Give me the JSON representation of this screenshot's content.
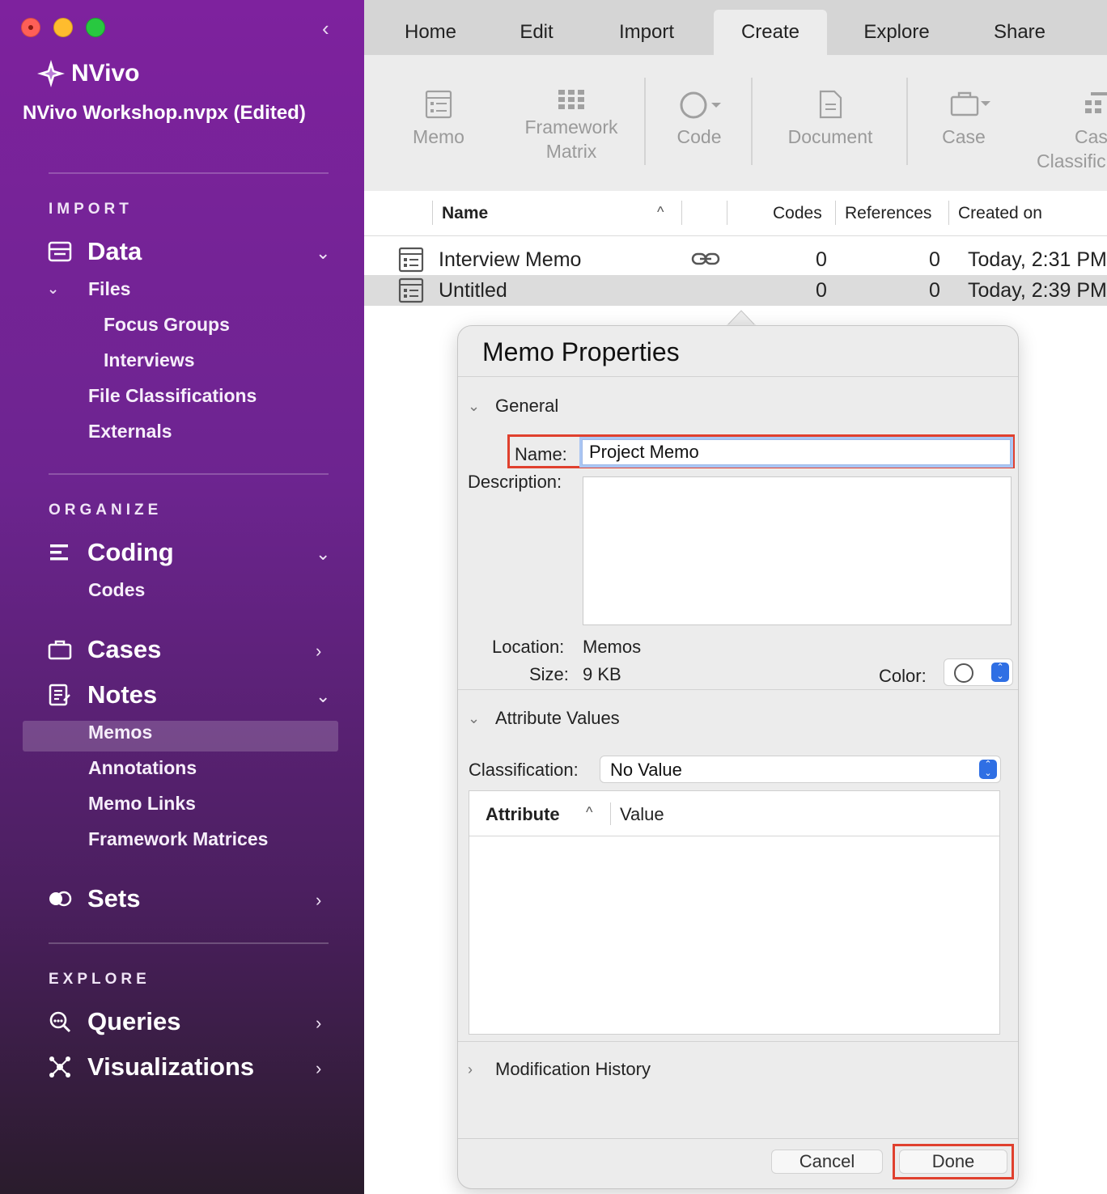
{
  "window": {
    "app_name": "NVivo",
    "project_title": "NVivo Workshop.nvpx (Edited)",
    "collapse_icon": "chevron-left-icon"
  },
  "sidebar": {
    "import": {
      "heading": "IMPORT",
      "data": {
        "label": "Data",
        "icon": "data-icon",
        "chevron": "⌄"
      },
      "files": {
        "label": "Files",
        "chevron": "⌄"
      },
      "items": [
        "Focus Groups",
        "Interviews",
        "File Classifications",
        "Externals"
      ]
    },
    "organize": {
      "heading": "ORGANIZE",
      "coding": {
        "label": "Coding",
        "chevron": "⌄"
      },
      "codes": "Codes",
      "cases": {
        "label": "Cases",
        "chevron": "›"
      },
      "notes": {
        "label": "Notes",
        "chevron": "⌄"
      },
      "notes_items": [
        "Memos",
        "Annotations",
        "Memo Links",
        "Framework Matrices"
      ],
      "selected": "Memos",
      "sets": {
        "label": "Sets",
        "chevron": "›"
      }
    },
    "explore": {
      "heading": "EXPLORE",
      "queries": {
        "label": "Queries",
        "chevron": "›"
      },
      "visualizations": {
        "label": "Visualizations",
        "chevron": "›"
      }
    }
  },
  "tabs": [
    "Home",
    "Edit",
    "Import",
    "Create",
    "Explore",
    "Share"
  ],
  "active_tab": "Create",
  "ribbon": {
    "memo": "Memo",
    "framework_line1": "Framework",
    "framework_line2": "Matrix",
    "code": "Code",
    "document": "Document",
    "case": "Case",
    "case_class_line1": "Cas",
    "case_class_line2": "Classific"
  },
  "list": {
    "columns": {
      "name": "Name",
      "codes": "Codes",
      "references": "References",
      "created": "Created on"
    },
    "rows": [
      {
        "name": "Interview Memo",
        "codes": "0",
        "references": "0",
        "created": "Today, 2:31 PM",
        "linked": true
      },
      {
        "name": "Untitled",
        "codes": "0",
        "references": "0",
        "created": "Today, 2:39 PM",
        "linked": false
      }
    ]
  },
  "dialog": {
    "title": "Memo Properties",
    "general": "General",
    "name_label": "Name:",
    "name_value": "Project Memo",
    "description_label": "Description:",
    "location_label": "Location:",
    "location_value": "Memos",
    "size_label": "Size:",
    "size_value": "9 KB",
    "color_label": "Color:",
    "attribute_values": "Attribute Values",
    "classification_label": "Classification:",
    "classification_value": "No Value",
    "attr_col": "Attribute",
    "value_col": "Value",
    "modification_history": "Modification History",
    "cancel": "Cancel",
    "done": "Done"
  },
  "colors": {
    "accent_highlight": "#e0402e",
    "sidebar_top": "#7e229e",
    "stepper_blue": "#2f6fe4"
  }
}
